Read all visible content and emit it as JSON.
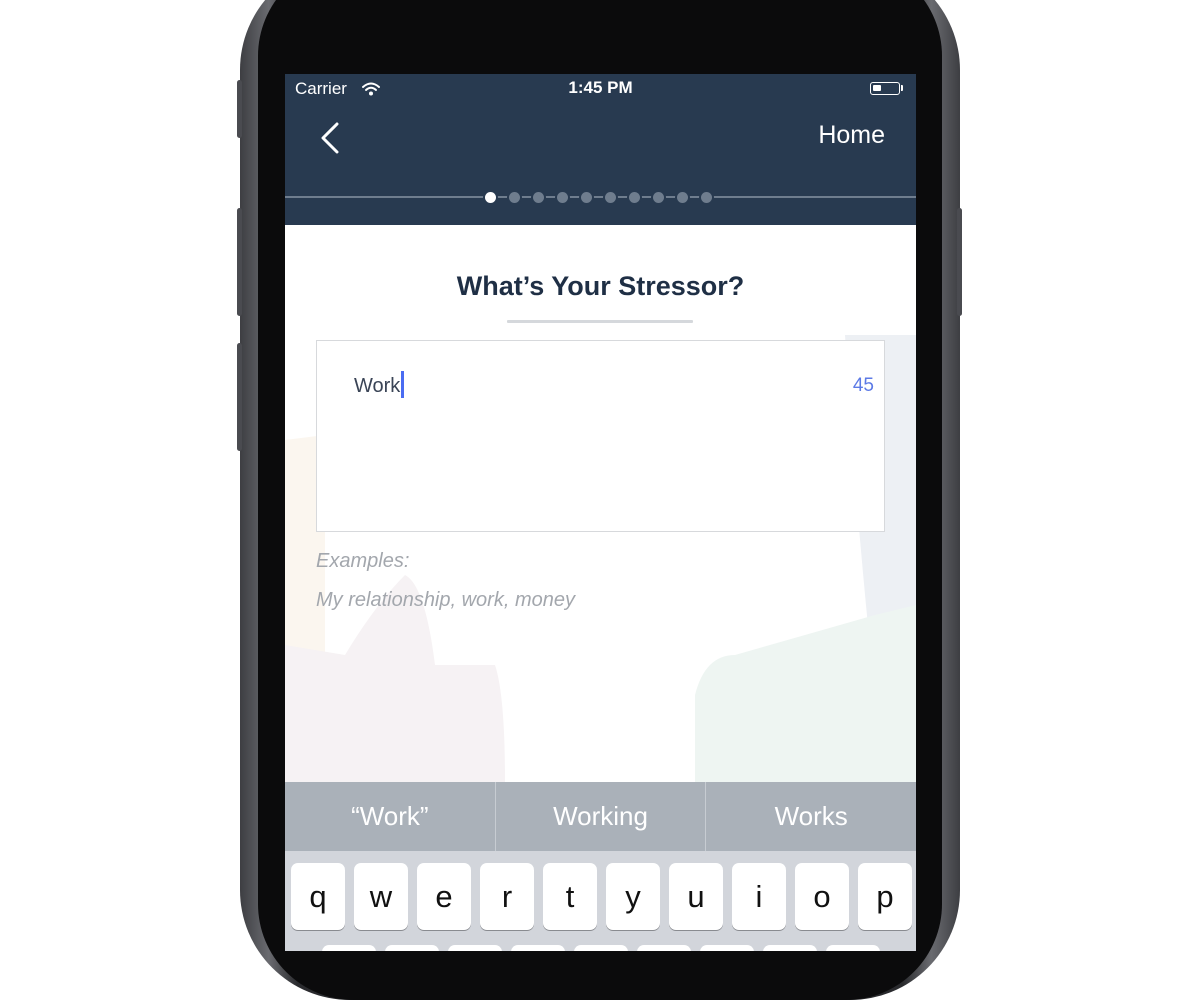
{
  "status_bar": {
    "carrier": "Carrier",
    "time": "1:45 PM",
    "battery_level": 0.35
  },
  "nav": {
    "back_icon": "chevron-left-icon",
    "home_label": "Home"
  },
  "progress": {
    "total_steps": 10,
    "current_step": 1
  },
  "question": {
    "title": "What’s Your Stressor?",
    "input_value": "Work",
    "char_count": "45"
  },
  "examples": {
    "label": "Examples:",
    "text": "My relationship, work, money"
  },
  "keyboard": {
    "suggestions": [
      "“Work”",
      "Working",
      "Works"
    ],
    "row1": [
      "q",
      "w",
      "e",
      "r",
      "t",
      "y",
      "u",
      "i",
      "o",
      "p"
    ]
  },
  "colors": {
    "header": "#283a50",
    "title": "#1f2f45",
    "accent": "#5c7ae6",
    "caret": "#4a6cf2",
    "suggestion_bar": "#aab1b9",
    "keyboard_bg": "#d2d5db"
  }
}
